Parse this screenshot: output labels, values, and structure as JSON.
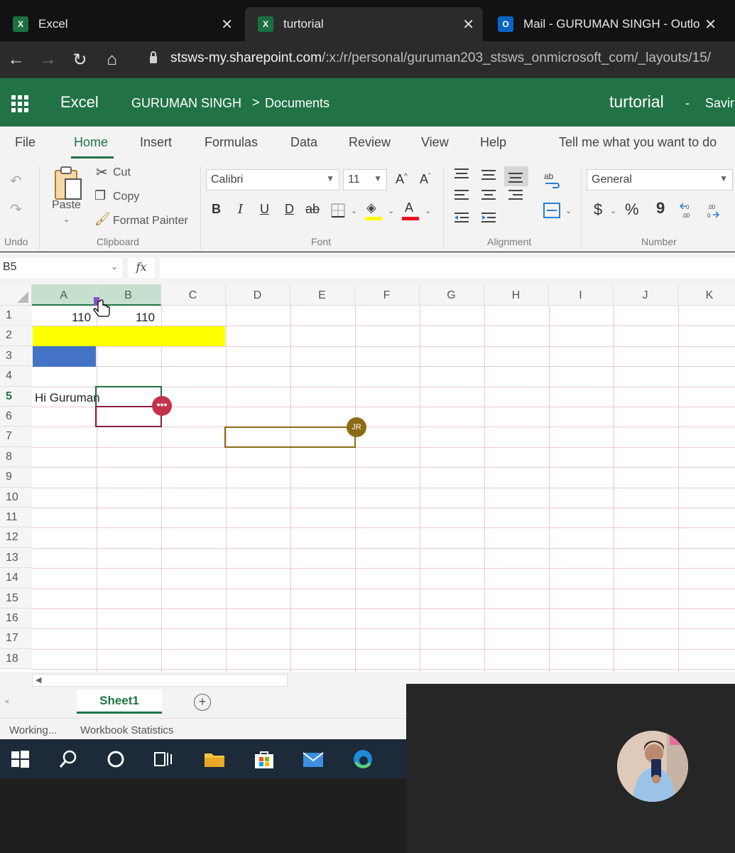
{
  "browser": {
    "tabs": [
      {
        "title": "Excel",
        "icon": "excel-icon"
      },
      {
        "title": "turtorial",
        "icon": "excel-icon"
      },
      {
        "title": "Mail - GURUMAN SINGH - Outlo",
        "icon": "outlook-icon"
      }
    ],
    "url_host": "stsws-my.sharepoint.com",
    "url_path": "/:x:/r/personal/guruman203_stsws_onmicrosoft_com/_layouts/15/"
  },
  "app": {
    "name": "Excel",
    "breadcrumb_owner": "GURUMAN SINGH",
    "breadcrumb_sep": ">",
    "breadcrumb_folder": "Documents",
    "file_title": "turtorial",
    "save_sep": "-",
    "save_status": "Savir"
  },
  "ribbon_tabs": [
    "File",
    "Home",
    "Insert",
    "Formulas",
    "Data",
    "Review",
    "View",
    "Help",
    "Tell me what you want to do"
  ],
  "ribbon": {
    "paste": "Paste",
    "cut": "Cut",
    "copy": "Copy",
    "format_painter": "Format Painter",
    "font_name": "Calibri",
    "font_size": "11",
    "number_format": "General",
    "groups": {
      "undo": "Undo",
      "clipboard": "Clipboard",
      "font": "Font",
      "alignment": "Alignment",
      "number": "Number"
    },
    "font_buttons": {
      "bold": "B",
      "italic": "I",
      "underline": "U",
      "double_underline": "D",
      "strike": "ab",
      "grow": "A",
      "shrink": "A",
      "font_color": "A"
    },
    "number_buttons": {
      "currency": "$",
      "percent": "%",
      "comma": "9"
    }
  },
  "formula_bar": {
    "name_box": "B5",
    "fx": "fx",
    "formula": ""
  },
  "grid": {
    "columns": [
      "A",
      "B",
      "C",
      "D",
      "E",
      "F",
      "G",
      "H",
      "I",
      "J",
      "K"
    ],
    "rows": [
      "1",
      "2",
      "3",
      "4",
      "5",
      "6",
      "7",
      "8",
      "9",
      "10",
      "11",
      "12",
      "13",
      "14",
      "15",
      "16",
      "17",
      "18"
    ],
    "cells": {
      "A1": "110",
      "B1": "110",
      "A5": "Hi Guruman"
    },
    "fills": {
      "row2": "#ffff00",
      "row3": "#4472c4"
    },
    "collaborator_badge": "JR",
    "collaborator_color": "#8b6b16",
    "selection_color": "#217346",
    "comment_color": "#c4314b"
  },
  "sheets": {
    "tabs": [
      "Sheet1"
    ],
    "add": "+"
  },
  "status": {
    "working": "Working...",
    "stats": "Workbook Statistics"
  },
  "colors": {
    "excel_green": "#217346",
    "taskbar": "#1c2a3a"
  }
}
